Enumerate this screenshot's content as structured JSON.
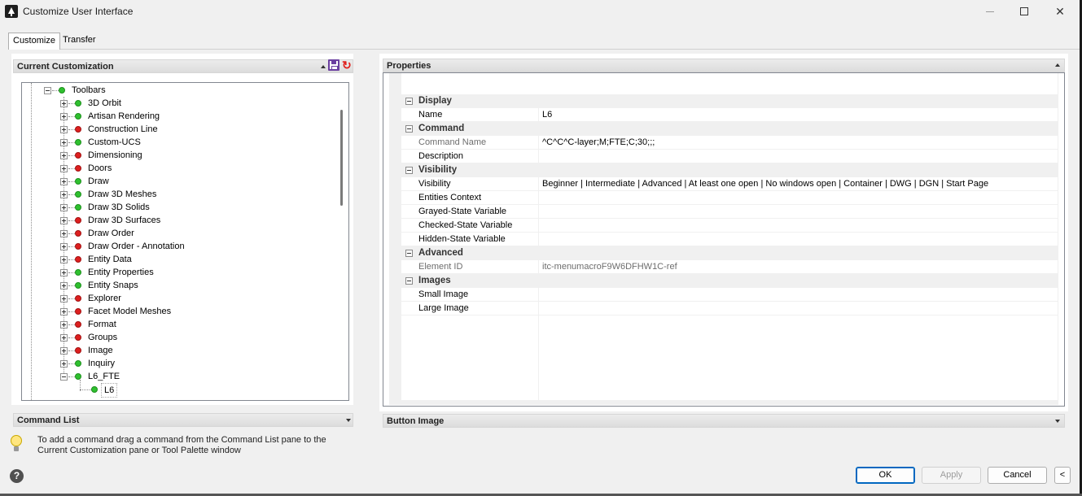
{
  "window": {
    "title": "Customize User Interface"
  },
  "tabs": [
    {
      "label": "Customize"
    },
    {
      "label": "Transfer"
    }
  ],
  "left": {
    "current_customization_header": "Current Customization",
    "command_list_header": "Command List",
    "tree": {
      "root": {
        "label": "Toolbars",
        "status": "green"
      },
      "items": [
        {
          "label": "3D Orbit",
          "status": "green"
        },
        {
          "label": "Artisan Rendering",
          "status": "green"
        },
        {
          "label": "Construction Line",
          "status": "red"
        },
        {
          "label": "Custom-UCS",
          "status": "green"
        },
        {
          "label": "Dimensioning",
          "status": "red"
        },
        {
          "label": "Doors",
          "status": "red"
        },
        {
          "label": "Draw",
          "status": "green"
        },
        {
          "label": "Draw 3D Meshes",
          "status": "green"
        },
        {
          "label": "Draw 3D Solids",
          "status": "green"
        },
        {
          "label": "Draw 3D Surfaces",
          "status": "red"
        },
        {
          "label": "Draw Order",
          "status": "red"
        },
        {
          "label": "Draw Order - Annotation",
          "status": "red"
        },
        {
          "label": "Entity Data",
          "status": "red"
        },
        {
          "label": "Entity Properties",
          "status": "green"
        },
        {
          "label": "Entity Snaps",
          "status": "green"
        },
        {
          "label": "Explorer",
          "status": "red"
        },
        {
          "label": "Facet Model Meshes",
          "status": "red"
        },
        {
          "label": "Format",
          "status": "red"
        },
        {
          "label": "Groups",
          "status": "red"
        },
        {
          "label": "Image",
          "status": "red"
        },
        {
          "label": "Inquiry",
          "status": "green"
        },
        {
          "label": "L6_FTE",
          "status": "green"
        }
      ],
      "child": {
        "label": "L6",
        "status": "green"
      }
    }
  },
  "right": {
    "properties_header": "Properties",
    "button_image_header": "Button Image",
    "categories": {
      "display": "Display",
      "command": "Command",
      "visibility": "Visibility",
      "advanced": "Advanced",
      "images": "Images"
    },
    "props": {
      "name": {
        "label": "Name",
        "value": "L6"
      },
      "command_name": {
        "label": "Command Name",
        "value": "^C^C^C-layer;M;FTE;C;30;;;"
      },
      "description": {
        "label": "Description",
        "value": ""
      },
      "visibility": {
        "label": "Visibility",
        "value": "Beginner | Intermediate | Advanced | At least one open | No windows open | Container | DWG | DGN | Start Page"
      },
      "entities_context": {
        "label": "Entities Context",
        "value": ""
      },
      "grayed_state": {
        "label": "Grayed-State Variable",
        "value": ""
      },
      "checked_state": {
        "label": "Checked-State Variable",
        "value": ""
      },
      "hidden_state": {
        "label": "Hidden-State Variable",
        "value": ""
      },
      "element_id": {
        "label": "Element ID",
        "value": "itc-menumacroF9W6DFHW1C-ref"
      },
      "small_image": {
        "label": "Small Image",
        "value": ""
      },
      "large_image": {
        "label": "Large Image",
        "value": ""
      }
    }
  },
  "hint": "To add a command drag a command from the Command List pane to the Current Customization pane or Tool Palette window",
  "buttons": {
    "ok": "OK",
    "apply": "Apply",
    "cancel": "Cancel",
    "more": "<"
  },
  "help_glyph": "?"
}
